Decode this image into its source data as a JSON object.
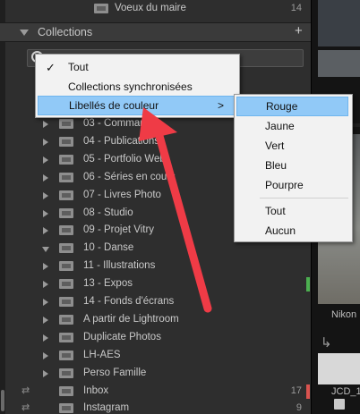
{
  "top_row": {
    "label": "Voeux du maire",
    "count": "14"
  },
  "collections_header": {
    "title": "Collections",
    "add_symbol": "+"
  },
  "collections": [
    {
      "label": "03 - Commandes",
      "expand": "closed",
      "count": "",
      "mark": ""
    },
    {
      "label": "04 - Publications",
      "expand": "closed",
      "count": "",
      "mark": ""
    },
    {
      "label": "05 - Portfolio Web",
      "expand": "closed",
      "count": "",
      "mark": ""
    },
    {
      "label": "06 - Séries en cours",
      "expand": "closed",
      "count": "",
      "mark": ""
    },
    {
      "label": "07 - Livres Photo",
      "expand": "closed",
      "count": "",
      "mark": ""
    },
    {
      "label": "08 - Studio",
      "expand": "closed",
      "count": "",
      "mark": ""
    },
    {
      "label": "09 - Projet Vitry",
      "expand": "closed",
      "count": "",
      "mark": ""
    },
    {
      "label": "10 - Danse",
      "expand": "open",
      "count": "",
      "mark": ""
    },
    {
      "label": "11 - Illustrations",
      "expand": "closed",
      "count": "",
      "mark": ""
    },
    {
      "label": "13 - Expos",
      "expand": "closed",
      "count": "",
      "mark": "#4caf50"
    },
    {
      "label": "14 - Fonds d'écrans",
      "expand": "closed",
      "count": "",
      "mark": ""
    },
    {
      "label": "A partir de Lightroom",
      "expand": "closed",
      "count": "",
      "mark": ""
    },
    {
      "label": "Duplicate Photos",
      "expand": "closed",
      "count": "",
      "mark": ""
    },
    {
      "label": "LH-AES",
      "expand": "closed",
      "count": "",
      "mark": ""
    },
    {
      "label": "Perso Famille",
      "expand": "closed",
      "count": "",
      "mark": ""
    },
    {
      "label": "Inbox",
      "expand": "none",
      "count": "17",
      "mark": "#d9534f",
      "synced": true
    },
    {
      "label": "Instagram",
      "expand": "none",
      "count": "9",
      "mark": "",
      "synced": true
    }
  ],
  "filter_menu": {
    "items": [
      {
        "label": "Tout",
        "checked": true,
        "submenu": false
      },
      {
        "label": "Collections synchronisées",
        "checked": false,
        "submenu": false
      },
      {
        "label": "Libellés de couleur",
        "checked": false,
        "submenu": true,
        "highlighted": true
      }
    ],
    "check_symbol": "✓",
    "submenu_symbol": ">"
  },
  "color_label_submenu": {
    "items": [
      "Rouge",
      "Jaune",
      "Vert",
      "Bleu",
      "Pourpre",
      "Tout",
      "Aucun"
    ],
    "highlighted": "Rouge"
  },
  "right_strip": {
    "caption1": "Nikon",
    "caption2": "JCD_1"
  },
  "colors": {
    "annotation_arrow": "#ef3b46",
    "highlight": "#91c9f7",
    "mark_red": "#d9534f",
    "mark_green": "#4caf50"
  }
}
